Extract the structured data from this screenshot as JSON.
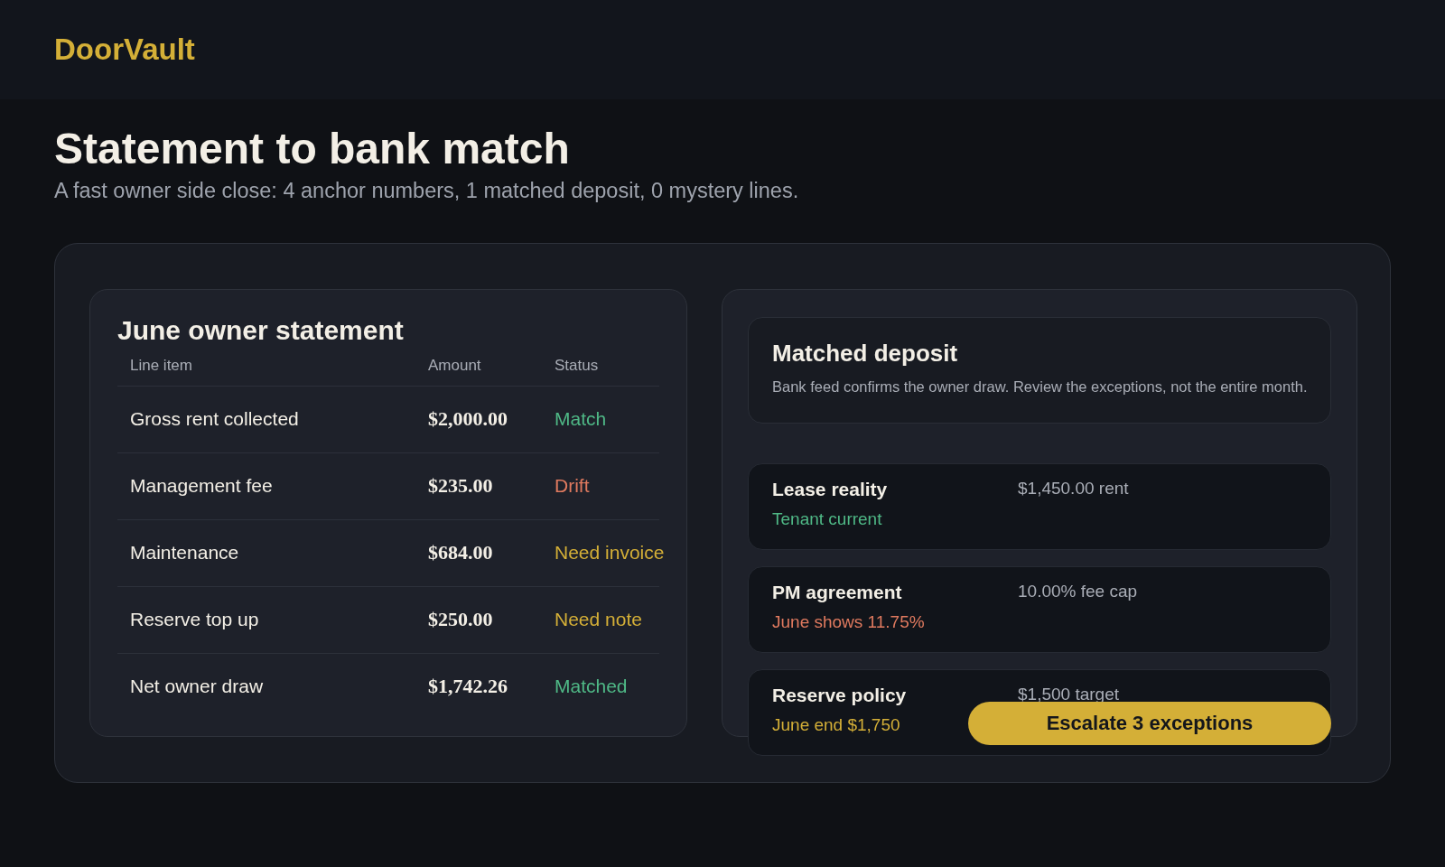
{
  "brand": "DoorVault",
  "title": "Statement to bank match",
  "subtitle": "A fast owner side close: 4 anchor numbers, 1 matched deposit, 0 mystery lines.",
  "statement": {
    "title": "June owner statement",
    "columns": [
      "Line item",
      "Amount",
      "Status"
    ],
    "rows": [
      {
        "item": "Gross rent collected",
        "amount": "$2,000.00",
        "status": "Match",
        "color": "#4fb886"
      },
      {
        "item": "Management fee",
        "amount": "$235.00",
        "status": "Drift",
        "color": "#e07a5f"
      },
      {
        "item": "Maintenance",
        "amount": "$684.00",
        "status": "Need invoice",
        "color": "#d4af37"
      },
      {
        "item": "Reserve top up",
        "amount": "$250.00",
        "status": "Need note",
        "color": "#d4af37"
      },
      {
        "item": "Net owner draw",
        "amount": "$1,742.26",
        "status": "Matched",
        "color": "#4fb886"
      }
    ]
  },
  "deposit": {
    "title": "Matched deposit",
    "text": "Bank feed confirms the owner draw. Review the exceptions, not the entire month."
  },
  "checks": [
    {
      "title": "Lease reality",
      "note": "Tenant current",
      "value": "$1,450.00 rent",
      "color": "#4fb886"
    },
    {
      "title": "PM agreement",
      "note": "June shows 11.75%",
      "value": "10.00% fee cap",
      "color": "#e07a5f"
    },
    {
      "title": "Reserve policy",
      "note": "June end $1,750",
      "value": "$1,500 target",
      "color": "#d4af37"
    }
  ],
  "button": "Escalate 3 exceptions"
}
